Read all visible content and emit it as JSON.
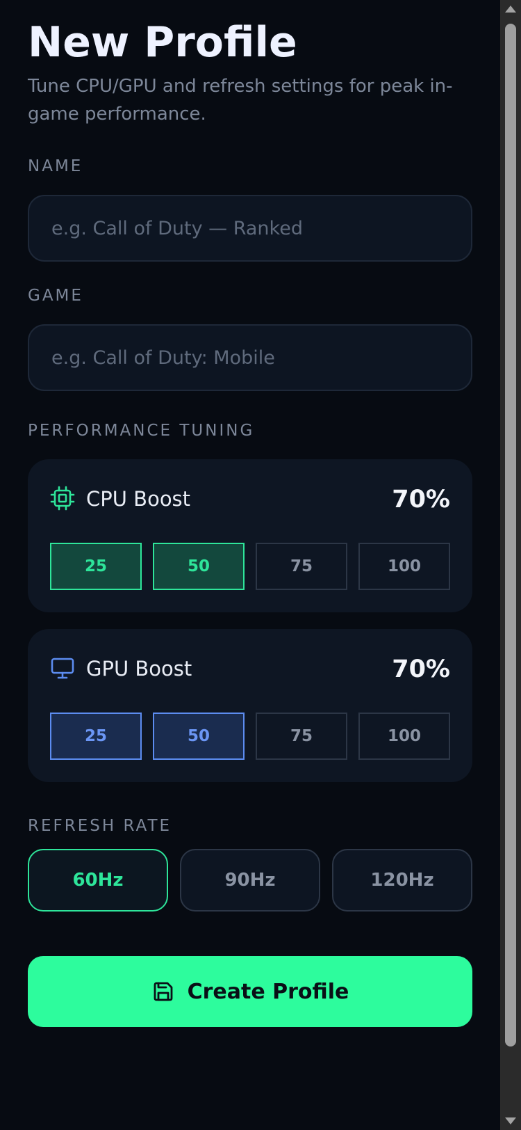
{
  "header": {
    "title": "New Profile",
    "subtitle": "Tune CPU/GPU and refresh settings for peak in-game performance."
  },
  "name_field": {
    "label": "NAME",
    "value": "",
    "placeholder": "e.g. Call of Duty — Ranked"
  },
  "game_field": {
    "label": "GAME",
    "value": "",
    "placeholder": "e.g. Call of Duty: Mobile"
  },
  "tuning": {
    "label": "PERFORMANCE TUNING",
    "cpu": {
      "title": "CPU Boost",
      "icon": "cpu-chip-icon",
      "value": "70%",
      "accent": "#2ee59a",
      "steps": [
        "25",
        "50",
        "75",
        "100"
      ],
      "active_steps": [
        "25",
        "50"
      ]
    },
    "gpu": {
      "title": "GPU Boost",
      "icon": "monitor-icon",
      "value": "70%",
      "accent": "#5c8cf0",
      "steps": [
        "25",
        "50",
        "75",
        "100"
      ],
      "active_steps": [
        "25",
        "50"
      ]
    }
  },
  "refresh": {
    "label": "REFRESH RATE",
    "options": [
      "60Hz",
      "90Hz",
      "120Hz"
    ],
    "selected": "60Hz"
  },
  "create_button": {
    "label": "Create Profile",
    "icon": "save-icon",
    "color": "#2dfc9d"
  }
}
